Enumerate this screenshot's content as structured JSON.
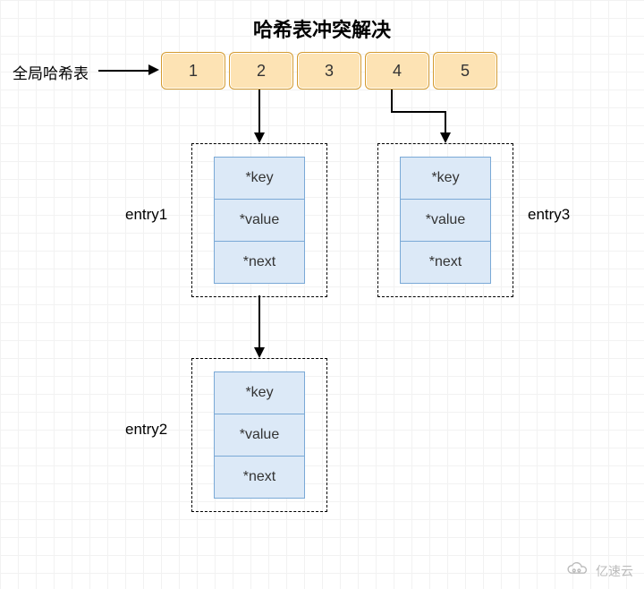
{
  "title": "哈希表冲突解决",
  "global_label": "全局哈希表",
  "buckets": [
    "1",
    "2",
    "3",
    "4",
    "5"
  ],
  "entry_labels": {
    "e1": "entry1",
    "e2": "entry2",
    "e3": "entry3"
  },
  "fields": {
    "key": "*key",
    "value": "*value",
    "next": "*next"
  },
  "watermark": "亿速云"
}
